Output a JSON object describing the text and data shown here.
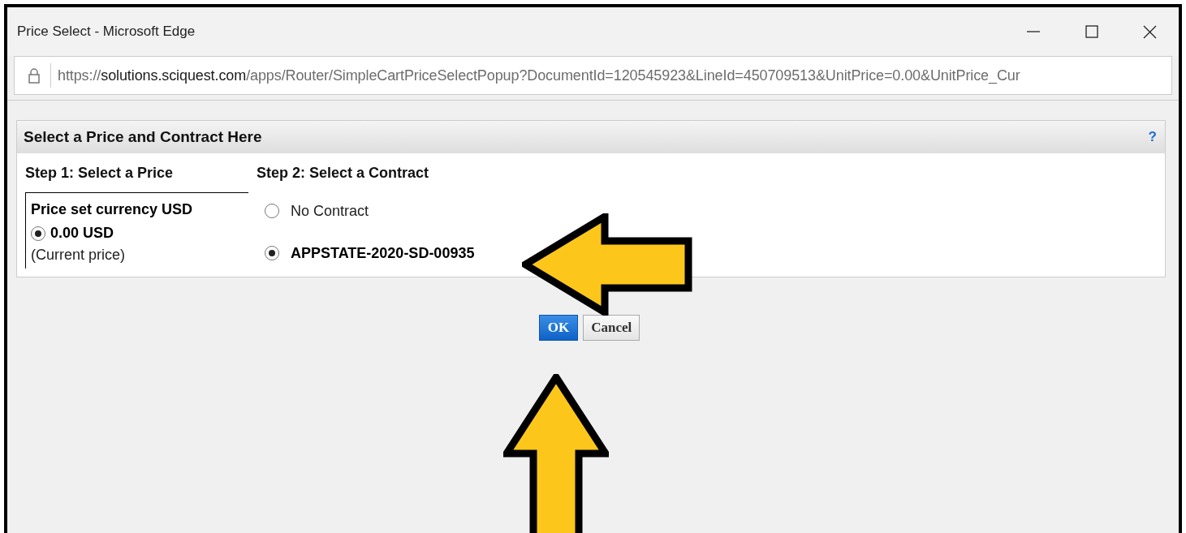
{
  "window": {
    "title": "Price Select - Microsoft Edge",
    "controls": [
      {
        "kind": "minimize"
      },
      {
        "kind": "maximize"
      },
      {
        "kind": "close"
      }
    ]
  },
  "address_bar": {
    "segments": [
      {
        "text": "https://",
        "emphasis": false
      },
      {
        "text": "solutions.sciquest.com",
        "emphasis": true
      },
      {
        "text": "/apps/Router/SimpleCartPriceSelectPopup?DocumentId=120545923&LineId=450709513&UnitPrice=0.00&UnitPrice_Cur",
        "emphasis": false
      }
    ]
  },
  "panel": {
    "title": "Select a Price and Contract Here",
    "help": "?",
    "step1": {
      "heading": "Step 1: Select a Price",
      "box_title": "Price set currency USD",
      "prices": [
        {
          "label": "0.00 USD",
          "note": "(Current price)",
          "selected": true
        }
      ]
    },
    "step2": {
      "heading": "Step 2: Select a Contract",
      "contracts": [
        {
          "label": "No Contract",
          "selected": false
        },
        {
          "label": "APPSTATE-2020-SD-00935",
          "selected": true
        }
      ]
    }
  },
  "buttons": [
    {
      "label": "OK",
      "kind": "primary"
    },
    {
      "label": "Cancel",
      "kind": "secondary"
    }
  ],
  "annotations": [
    {
      "kind": "arrow_left"
    },
    {
      "kind": "arrow_up"
    }
  ]
}
